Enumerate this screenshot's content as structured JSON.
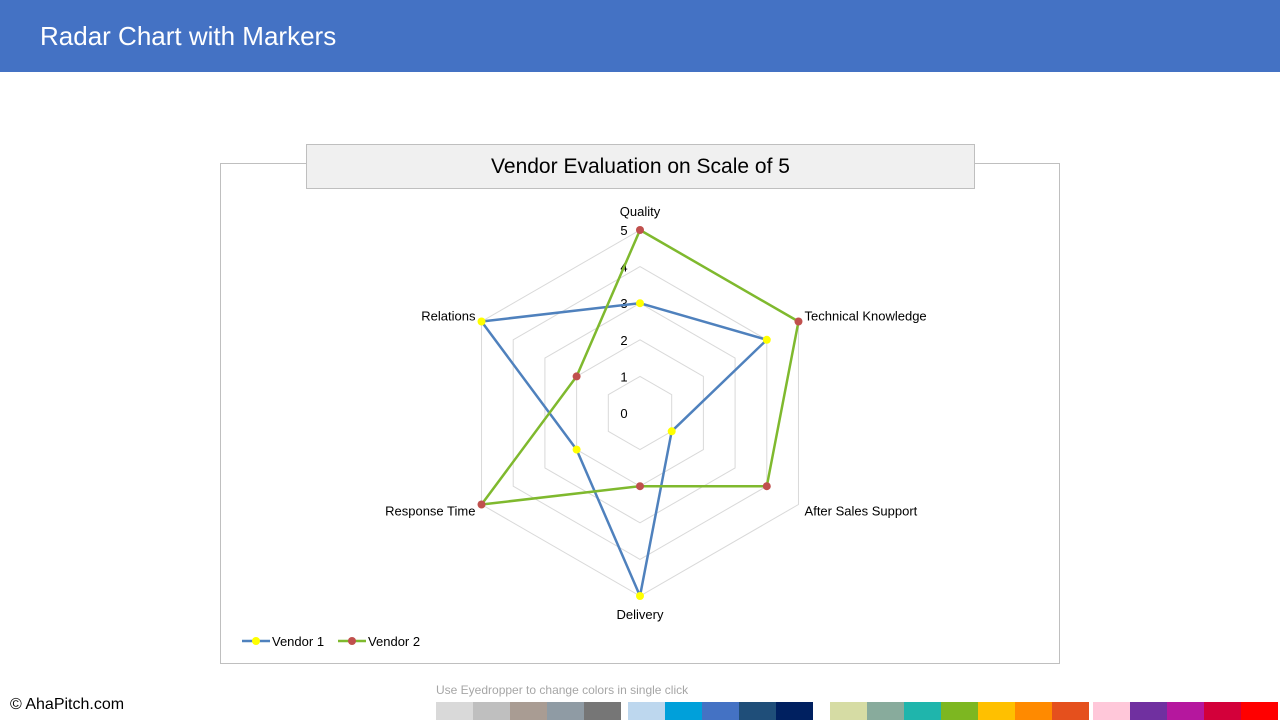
{
  "header": {
    "title": "Radar Chart with Markers"
  },
  "chart_data": {
    "type": "radar",
    "title": "Vendor Evaluation on Scale of 5",
    "categories": [
      "Quality",
      "Technical Knowledge",
      "After Sales Support",
      "Delivery",
      "Response Time",
      "Relations"
    ],
    "rlim": [
      0,
      5
    ],
    "ticks": [
      "0",
      "1",
      "2",
      "3",
      "4",
      "5"
    ],
    "grid": true,
    "legend": "bottom-left",
    "series": [
      {
        "name": "Vendor 1",
        "values": [
          3,
          4,
          1,
          5,
          2,
          5
        ],
        "line_color": "#4F81BD",
        "marker_color": "#FFFF00"
      },
      {
        "name": "Vendor 2",
        "values": [
          5,
          5,
          4,
          2,
          5,
          2
        ],
        "line_color": "#7FB92E",
        "marker_color": "#C0504D"
      }
    ]
  },
  "footer": {
    "copyright": "© AhaPitch.com",
    "eyedropper_hint": "Use Eyedropper to change colors in single click"
  },
  "palette": {
    "groups": [
      [
        "#d9d9d9",
        "#bfbfbf",
        "#a99c93",
        "#8f9ba4",
        "#767676"
      ],
      [
        "#bdd7ee",
        "#00a0da",
        "#4472c4",
        "#1f4e79",
        "#002060"
      ],
      [
        "#d6dca4",
        "#88ab9c",
        "#1fb5ac",
        "#7db721",
        "#ffc000",
        "#ff8a00",
        "#e5501d"
      ],
      [
        "#ffc7d9",
        "#7030a0",
        "#b5179e",
        "#d3003a",
        "#ff0000"
      ]
    ]
  }
}
